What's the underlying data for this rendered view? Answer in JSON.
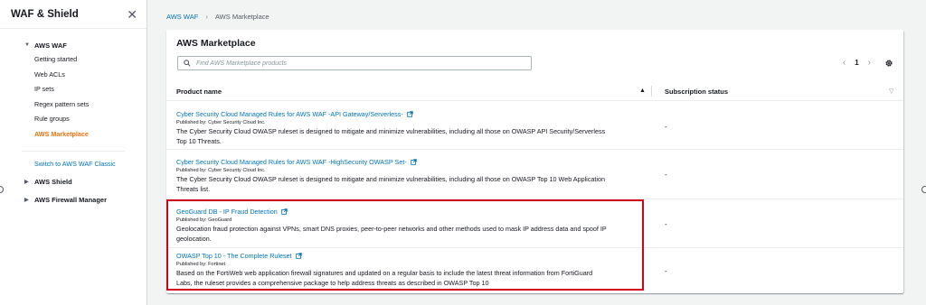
{
  "sidebar": {
    "title": "WAF & Shield",
    "close_icon": "close-icon",
    "sections": {
      "waf": "AWS WAF",
      "shield": "AWS Shield",
      "firewall": "AWS Firewall Manager"
    },
    "items": [
      {
        "label": "Getting started"
      },
      {
        "label": "Web ACLs"
      },
      {
        "label": "IP sets"
      },
      {
        "label": "Regex pattern sets"
      },
      {
        "label": "Rule groups"
      },
      {
        "label": "AWS Marketplace"
      }
    ],
    "classic_link": "Switch to AWS WAF Classic",
    "active_color": "#ec7211"
  },
  "breadcrumb": {
    "root": "AWS WAF",
    "current": "AWS Marketplace"
  },
  "panel": {
    "title": "AWS Marketplace",
    "search_placeholder": "Find AWS Marketplace products",
    "page_number": "1"
  },
  "table": {
    "columns": [
      "Product name",
      "Subscription status"
    ],
    "rows": [
      {
        "name": "Cyber Security Cloud Managed Rules for AWS WAF -API Gateway/Serverless-",
        "publisher": "Published by: Cyber Security Cloud Inc.",
        "desc1": "The Cyber Security Cloud OWASP ruleset is designed to mitigate and minimize vulnerabilities, including all those on OWASP API Security/Serverless",
        "desc2": "Top 10 Threats.",
        "status": "-"
      },
      {
        "name": "Cyber Security Cloud Managed Rules for AWS WAF -HighSecurity OWASP Set-",
        "publisher": "Published by: Cyber Security Cloud Inc.",
        "desc1": "The Cyber Security Cloud OWASP ruleset is designed to mitigate and minimize vulnerabilities, including all those on OWASP Top 10 Web Application",
        "desc2": "Threats list.",
        "status": "-"
      },
      {
        "name": "GeoGuard DB - IP Fraud Detection",
        "publisher": "Published by: GeoGuard",
        "desc1": "Geolocation fraud protection against VPNs, smart DNS proxies, peer-to-peer networks and other methods used to mask IP address data and spoof IP",
        "desc2": "geolocation.",
        "status": "-"
      },
      {
        "name": "OWASP Top 10 - The Complete Ruleset",
        "publisher": "Published by: Fortinet",
        "desc1": "Based on the FortiWeb web application firewall signatures and updated on a regular basis to include the latest threat information from FortiGuard",
        "desc2": "Labs, the ruleset provides a comprehensive package to help address threats as described in OWASP Top 10",
        "status": "-"
      }
    ]
  },
  "colors": {
    "link": "#0073bb",
    "highlight_border": "#d0021b"
  }
}
